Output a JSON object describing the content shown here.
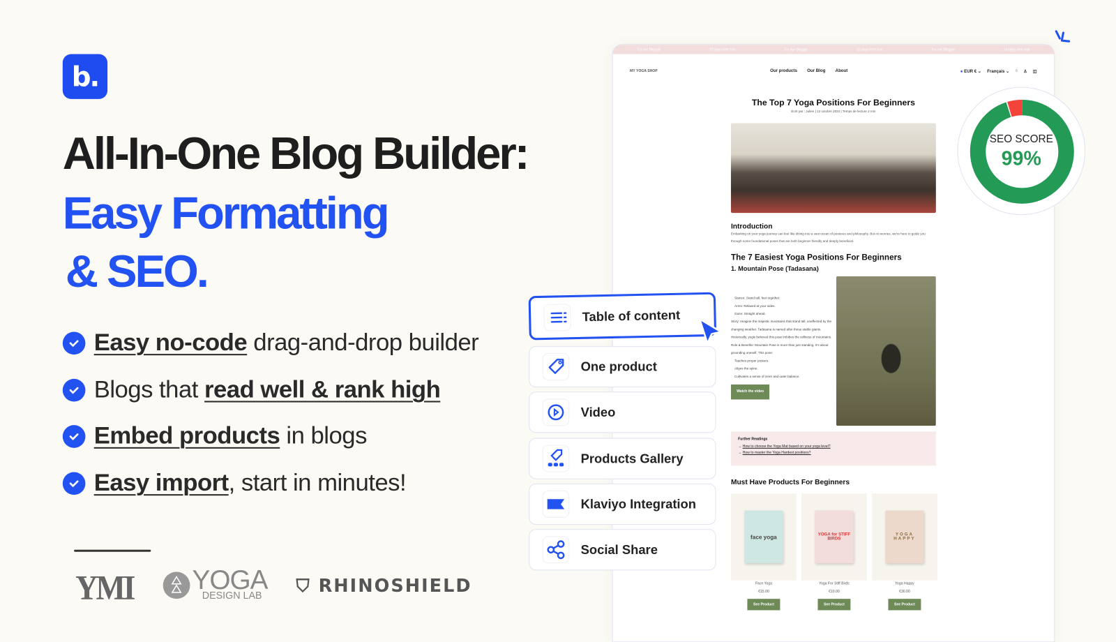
{
  "logo_letter": "b.",
  "headline": {
    "line1": "All-In-One Blog Builder:",
    "line2": "Easy Formatting",
    "line3": "& SEO."
  },
  "features": [
    {
      "bold": "Easy no-code",
      "rest": " drag-and-drop builder",
      "bold_first": true
    },
    {
      "pre": "Blogs that ",
      "bold": "read well & rank high"
    },
    {
      "bold": "Embed products",
      "rest": " in blogs"
    },
    {
      "bold": "Easy import",
      "rest": ", start in minutes!"
    }
  ],
  "brands": [
    "YMI",
    "YOGA",
    "DESIGN LAB",
    "RHINOSHIELD"
  ],
  "colors": {
    "accent": "#2352f2",
    "seo_green": "#239a55",
    "seo_red": "#f2443a",
    "button_green": "#6e8a57"
  },
  "mockup": {
    "promo": [
      "Try our Bloggle",
      "10 days free trial",
      "Try our Bloggle",
      "10 days free trial",
      "Try our Bloggle",
      "10 days free trial"
    ],
    "shop_name": "MY YOGA SHOP",
    "nav": [
      "Our products",
      "Our Blog",
      "About"
    ],
    "currency": "EUR €",
    "language": "Français",
    "title": "The Top 7 Yoga Positions For Beginners",
    "meta": "Écrit par : Julien  |  12 octobre 2023  |  Temps de lecture 2 min",
    "intro_heading": "Introduction",
    "intro_text": "Embarking on your yoga journey can feel like diving into a vast ocean of postures and philosophy. But no worries, we're here to guide you through some foundational poses that are both beginner-friendly and deeply beneficial.",
    "section_heading": "The 7 Easiest Yoga Positions For Beginners",
    "pose_heading": "1. Mountain Pose (Tadasana)",
    "pose_lines": [
      "Stance: Stand tall, feet together.",
      "Arms: Relaxed at your sides.",
      "Gaze: Straight ahead.",
      "Story: Imagine the majestic mountains that stand tall, unaffected by the changing weather. Tadasana is named after these stable giants. Historically, yogis believed this pose imbibes the stillness of mountains.",
      "Role & Benefits: Mountain Pose is more than just standing. It's about grounding oneself. This pose:",
      "Teaches proper posture.",
      "Aligns the spine.",
      "Cultivates a sense of inner and outer balance."
    ],
    "video_button": "Watch the video",
    "further_heading": "Further Readings",
    "further_links": [
      "How to choose the Yoga Mat based on your yoga level?",
      "How to master the Yoga Hardest positions?"
    ],
    "products_heading": "Must Have Products For Beginners",
    "products": [
      {
        "name": "Face Yoga",
        "price": "€15.00",
        "cover": "face yoga",
        "button": "See Product"
      },
      {
        "name": "Yoga For Stiff Birds",
        "price": "€10.00",
        "cover": "YOGA for STIFF BIRDS",
        "button": "See Product"
      },
      {
        "name": "Yoga Happy",
        "price": "€30.00",
        "cover": "YOGA HAPPY",
        "button": "See Product"
      }
    ]
  },
  "blocks": [
    {
      "label": "Table of content",
      "icon": "list-icon",
      "selected": true
    },
    {
      "label": "One product",
      "icon": "tag-icon"
    },
    {
      "label": "Video",
      "icon": "play-icon"
    },
    {
      "label": "Products Gallery",
      "icon": "tag-gallery-icon"
    },
    {
      "label": "Klaviyo Integration",
      "icon": "klaviyo-flag-icon"
    },
    {
      "label": "Social Share",
      "icon": "share-icon"
    }
  ],
  "seo": {
    "label": "SEO SCORE",
    "value_text": "99%",
    "value": 95
  }
}
